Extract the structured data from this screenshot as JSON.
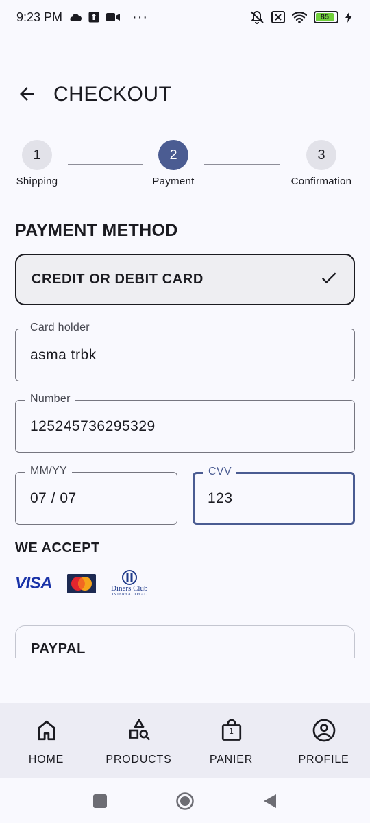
{
  "status_bar": {
    "time": "9:23 PM",
    "dots": "···",
    "battery": "85",
    "icons": [
      "cloud-icon",
      "upload-icon",
      "video-icon",
      "mute-icon",
      "no-sim-icon",
      "wifi-icon",
      "battery-icon",
      "charging-icon"
    ]
  },
  "header": {
    "title": "CHECKOUT",
    "back_icon": "arrow-left-icon"
  },
  "stepper": {
    "steps": [
      {
        "number": "1",
        "label": "Shipping",
        "active": false
      },
      {
        "number": "2",
        "label": "Payment",
        "active": true
      },
      {
        "number": "3",
        "label": "Confirmation",
        "active": false
      }
    ]
  },
  "payment": {
    "section_title": "PAYMENT METHOD",
    "selected_method": "CREDIT OR DEBIT CARD",
    "selected_icon": "checkmark-icon",
    "fields": {
      "card_holder": {
        "label": "Card holder",
        "value": "asma trbk"
      },
      "number": {
        "label": "Number",
        "value": "125245736295329"
      },
      "expiry": {
        "label": "MM/YY",
        "value": "07 / 07"
      },
      "cvv": {
        "label": "CVV",
        "value": "123"
      }
    },
    "accept_title": "WE ACCEPT",
    "logos": {
      "visa": "VISA",
      "mastercard": "MasterCard",
      "diners": "Diners Club",
      "diners_sub": "INTERNATIONAL"
    },
    "paypal_label": "PAYPAL"
  },
  "bottom_nav": {
    "items": [
      {
        "label": "HOME",
        "icon": "home-icon"
      },
      {
        "label": "PRODUCTS",
        "icon": "shapes-search-icon"
      },
      {
        "label": "PANIER",
        "icon": "shopping-bag-icon",
        "badge": "1"
      },
      {
        "label": "PROFILE",
        "icon": "account-circle-icon"
      }
    ]
  },
  "colors": {
    "accent": "#4b5c92",
    "background": "#f9f9fe",
    "nav_background": "#ececf4",
    "text": "#1b1b21"
  }
}
